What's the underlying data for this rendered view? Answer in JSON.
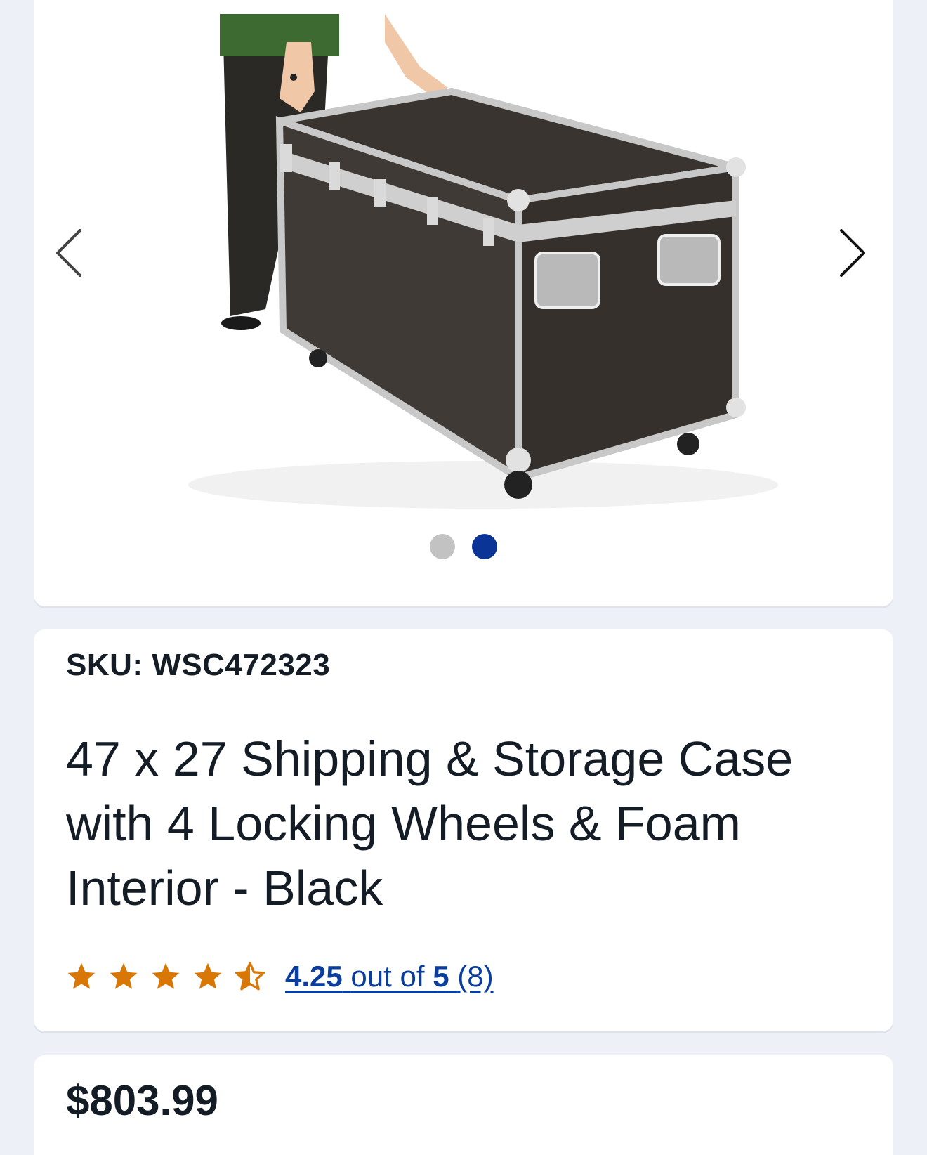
{
  "gallery": {
    "image_alt": "Black shipping and storage case with aluminum trim and locking wheels",
    "prev_icon": "chevron-left-icon",
    "next_icon": "chevron-right-icon",
    "dots_count": 2,
    "active_dot": 2,
    "colors": {
      "dot_inactive": "#c2c2c2",
      "dot_active": "#0a3496"
    }
  },
  "product": {
    "sku_label": "SKU: WSC472323",
    "title": "47 x 27 Shipping & Storage Case with 4 Locking Wheels & Foam Interior - Black",
    "rating": {
      "value": "4.25",
      "out_of_text": "out of",
      "max": "5",
      "count_text": "(8)",
      "stars_filled": 4,
      "stars_half": 1,
      "star_color": "#d97706"
    }
  },
  "pricing": {
    "price": "$803.99"
  }
}
